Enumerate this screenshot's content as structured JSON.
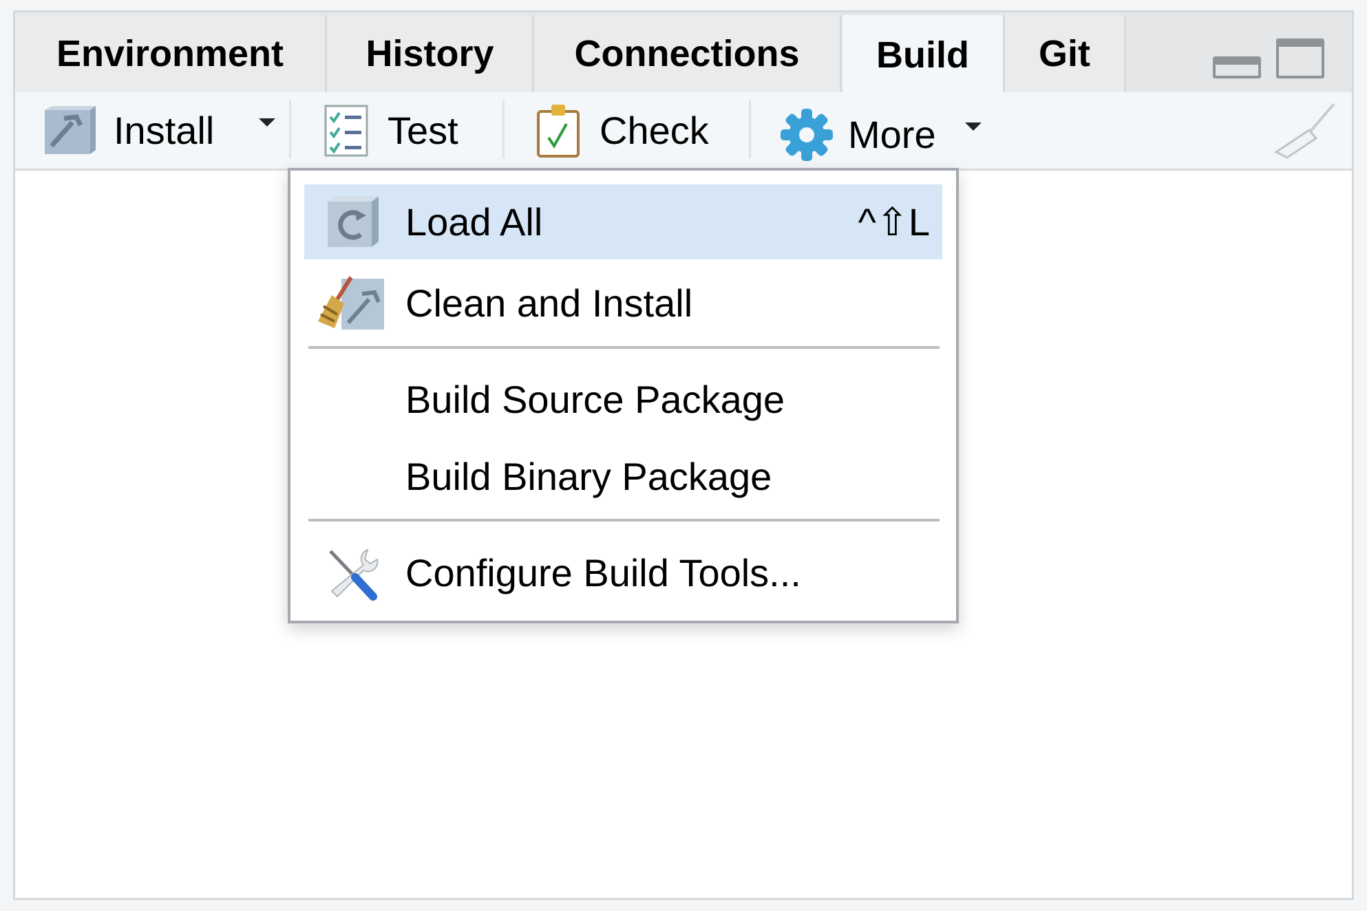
{
  "tabs": [
    {
      "label": "Environment",
      "active": false
    },
    {
      "label": "History",
      "active": false
    },
    {
      "label": "Connections",
      "active": false
    },
    {
      "label": "Build",
      "active": true
    },
    {
      "label": "Git",
      "active": false
    }
  ],
  "toolbar": {
    "install": {
      "label": "Install",
      "icon": "hammer-box-icon"
    },
    "test": {
      "label": "Test",
      "icon": "checklist-icon"
    },
    "check": {
      "label": "Check",
      "icon": "clipboard-check-icon"
    },
    "more": {
      "label": "More",
      "icon": "gear-icon"
    },
    "clear": {
      "icon": "broom-icon"
    }
  },
  "menu": {
    "items": [
      {
        "label": "Load All",
        "shortcut": "^⇧L",
        "icon": "reload-box-icon",
        "highlighted": true
      },
      {
        "label": "Clean and Install",
        "icon": "broom-hammer-icon"
      },
      {
        "label": "Build Source Package"
      },
      {
        "label": "Build Binary Package"
      },
      {
        "label": "Configure Build Tools...",
        "icon": "tools-icon"
      }
    ]
  },
  "colors": {
    "highlight": "#d6e6f7",
    "gear": "#3aa0d8",
    "check": "#2e9b3a"
  }
}
